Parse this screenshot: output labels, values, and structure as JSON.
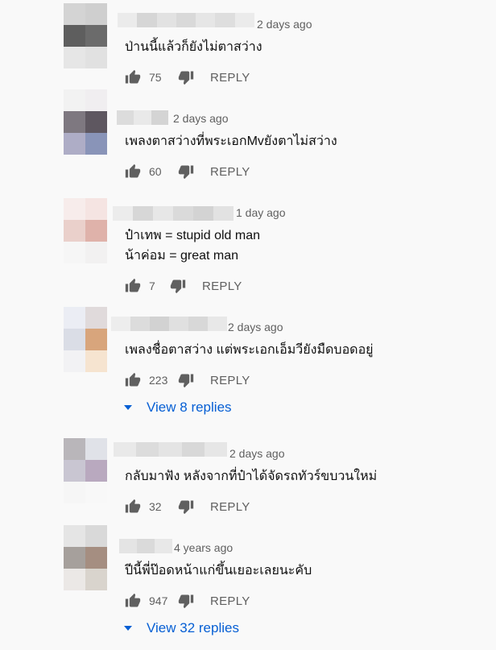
{
  "comments": [
    {
      "time": "2 days ago",
      "text": [
        "ป่านนี้แล้วก็ยังไม่ตาสว่าง"
      ],
      "likes": "75",
      "reply_label": "REPLY",
      "avatar_colors": [
        "#d4d4d4",
        "#cfcfcf",
        "#5e5e5e",
        "#6b6b6b",
        "#e6e6e6",
        "#e1e1e1"
      ],
      "name_colors": [
        "#ebebeb",
        "#d6d6d6",
        "#e2e2e2",
        "#d9d9d9",
        "#e6e6e6",
        "#dedede",
        "#ebebeb"
      ]
    },
    {
      "time": "2 days ago",
      "text": [
        "เพลงตาสว่างที่พระเอกMvยังตาไม่สว่าง"
      ],
      "likes": "60",
      "reply_label": "REPLY",
      "avatar_colors": [
        "#f2f2f2",
        "#f0eef0",
        "#7e7880",
        "#5e5760",
        "#aeadc6",
        "#8994b8"
      ],
      "name_colors": [
        "#dcdcdc",
        "#e9e9e9",
        "#d4d4d4"
      ]
    },
    {
      "time": "1 day ago",
      "text": [
        "ป๋าเทพ = stupid old man",
        "น้าค่อม = great man"
      ],
      "likes": "7",
      "reply_label": "REPLY",
      "avatar_colors": [
        "#f7eceb",
        "#f5e4e2",
        "#ead0cb",
        "#dfb2aa",
        "#f6f6f6",
        "#f2f1f1"
      ],
      "name_colors": [
        "#ececec",
        "#d7d7d7",
        "#e7e7e7",
        "#dadada",
        "#d3d3d3",
        "#e2e2e2"
      ]
    },
    {
      "time": "2 days ago",
      "text": [
        "เพลงชื่อตาสว่าง แต่พระเอกเอ็มวียังมืดบอดอยู่"
      ],
      "likes": "223",
      "reply_label": "REPLY",
      "replies_label": "View 8 replies",
      "avatar_colors": [
        "#ebedf4",
        "#e0dadb",
        "#dadde6",
        "#d8a57c",
        "#f2f2f4",
        "#f6e4d0"
      ],
      "name_colors": [
        "#ededed",
        "#dcdcdc",
        "#d2d2d2",
        "#e0e0e0",
        "#d8d8d8",
        "#e8e8e8"
      ]
    },
    {
      "time": "2 days ago",
      "text": [
        "กลับมาฟัง หลังจากที่ป๋าได้จัดรถทัวร์ขบวนใหม่"
      ],
      "likes": "32",
      "reply_label": "REPLY",
      "avatar_colors": [
        "#b9b6ba",
        "#e0e2e8",
        "#c9c6d2",
        "#b9a9bf",
        "#f6f6f6",
        "#f8f8f8"
      ],
      "name_colors": [
        "#e9e9e9",
        "#dcdcdc",
        "#e4e4e4",
        "#d8d8d8",
        "#e6e6e6"
      ]
    },
    {
      "time": "4 years ago",
      "text": [
        "ปีนี้พี่ป๊อดหน้าแก่ขึ้นเยอะเลยนะคับ"
      ],
      "likes": "947",
      "reply_label": "REPLY",
      "replies_label": "View 32 replies",
      "avatar_colors": [
        "#e5e5e5",
        "#d9d9d9",
        "#a6a09c",
        "#a58e81",
        "#ebe8e6",
        "#d9d4cd"
      ],
      "name_colors": [
        "#e4e4e4",
        "#dadada",
        "#e8e8e8"
      ]
    }
  ],
  "colors": {
    "background": "#f9f9f9",
    "text": "#0f0f0f",
    "secondary": "#606060",
    "link": "#065fd4"
  },
  "icons": {
    "like": "thumbs-up-icon",
    "dislike": "thumbs-down-icon",
    "expand": "caret-down-icon"
  }
}
